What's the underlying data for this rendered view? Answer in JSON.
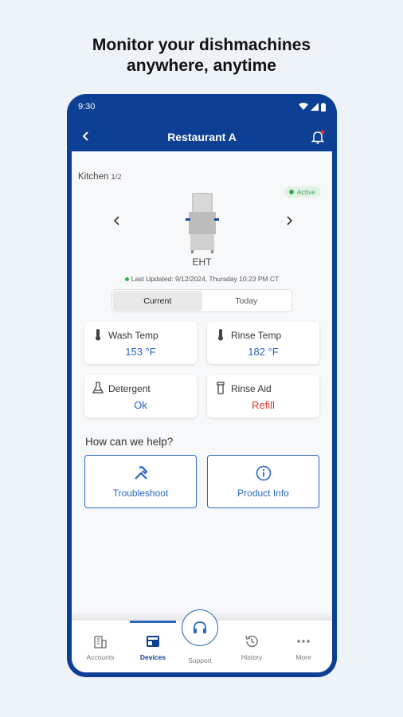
{
  "headline": {
    "line1": "Monitor your dishmachines",
    "line2": "anywhere, anytime"
  },
  "status": {
    "time": "9:30"
  },
  "appbar": {
    "title": "Restaurant A",
    "back_icon": "chevron-left-icon",
    "bell_icon": "bell-icon"
  },
  "location": {
    "name": "Kitchen",
    "count": "1/2"
  },
  "badge": {
    "label": "Active",
    "color": "#2db34a"
  },
  "machine": {
    "model": "EHT",
    "last_updated": "Last Updated: 9/12/2024, Thursday 10:23 PM CT"
  },
  "segments": {
    "current": "Current",
    "today": "Today",
    "selected": "Current"
  },
  "metrics": {
    "wash_temp": {
      "label": "Wash Temp",
      "value": "153 °F"
    },
    "rinse_temp": {
      "label": "Rinse Temp",
      "value": "182 °F"
    },
    "detergent": {
      "label": "Detergent",
      "value": "Ok"
    },
    "rinse_aid": {
      "label": "Rinse Aid",
      "value": "Refill"
    }
  },
  "help": {
    "title": "How can we help?",
    "troubleshoot": "Troubleshoot",
    "product_info": "Product Info"
  },
  "tabs": {
    "accounts": "Accounts",
    "devices": "Devices",
    "support": "Support",
    "history": "History",
    "more": "More",
    "active": "Devices"
  },
  "colors": {
    "brand": "#0d3f94",
    "accent": "#2a66c4",
    "warning": "#e0382f"
  }
}
